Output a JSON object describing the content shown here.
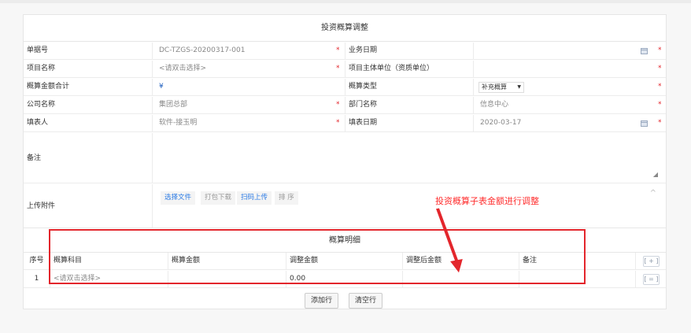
{
  "form": {
    "title": "投资概算调整",
    "rows": [
      {
        "label": "单据号",
        "value": "DC-TZGS-20200317-001",
        "label2": "业务日期",
        "value2": ""
      },
      {
        "label": "项目名称",
        "value": "<请双击选择>",
        "label2": "项目主体单位（资质单位）",
        "value2": ""
      },
      {
        "label": "概算金额合计",
        "value": "¥",
        "label2": "概算类型",
        "value2": "补充概算"
      },
      {
        "label": "公司名称",
        "value": "集团总部",
        "label2": "部门名称",
        "value2": "信息中心"
      },
      {
        "label": "填表人",
        "value": "软件-接玉明",
        "label2": "填表日期",
        "value2": "2020-03-17"
      }
    ],
    "required_mark": "*",
    "remarks_label": "备注",
    "remarks_value": "",
    "upload_label": "上传附件",
    "upload_buttons": [
      "选择文件",
      "打包下载",
      "扫码上传",
      "排 序"
    ]
  },
  "annotation": "投资概算子表金额进行调整",
  "detail": {
    "title": "概算明细",
    "columns": [
      "序号",
      "概算科目",
      "概算金额",
      "调整金额",
      "调整后金额",
      "备注"
    ],
    "add_col_btn": "[ + ]",
    "rows": [
      {
        "index": "1",
        "subject": "<请双击选择>",
        "amount": "",
        "adjust": "0.00",
        "after": "",
        "remark": "",
        "row_btn": "[ = ]"
      }
    ]
  },
  "actions": {
    "add_row": "添加行",
    "clear_rows": "清空行"
  },
  "colors": {
    "required": "#e3262c",
    "link": "#2c7be5",
    "annotation": "#ff2d2d"
  }
}
